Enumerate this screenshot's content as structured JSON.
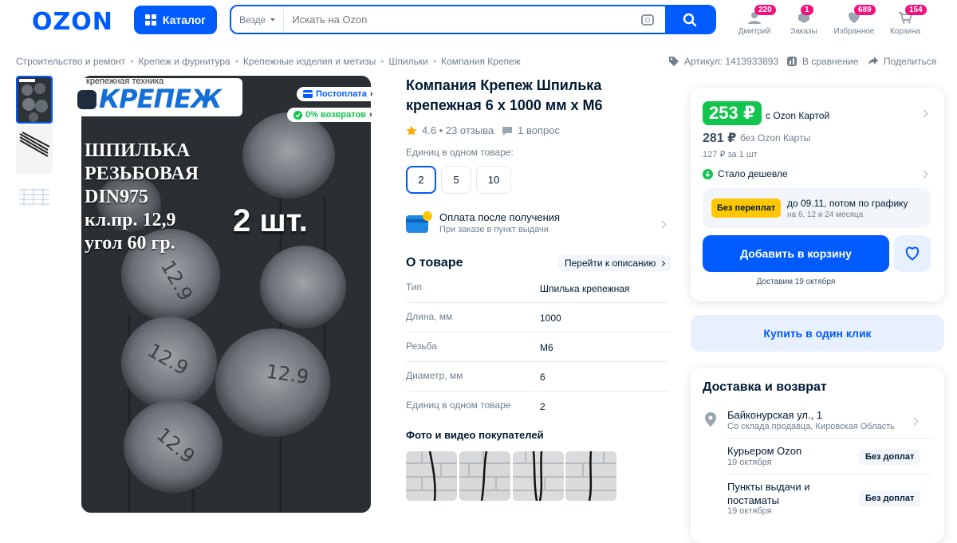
{
  "header": {
    "logo": "OZON",
    "catalog_label": "Каталог",
    "search_scope": "Везде",
    "search_placeholder": "Искать на Ozon",
    "nav": [
      {
        "label": "Дмитрий",
        "badge": "220",
        "icon": "user-icon"
      },
      {
        "label": "Заказы",
        "badge": "1",
        "icon": "box-icon"
      },
      {
        "label": "Избранное",
        "badge": "689",
        "icon": "heart-icon"
      },
      {
        "label": "Корзина",
        "badge": "154",
        "icon": "cart-icon"
      }
    ]
  },
  "breadcrumbs": [
    "Строительство и ремонт",
    "Крепеж и фурнитура",
    "Крепежные изделия и метизы",
    "Шпильки",
    "Компания Крепеж"
  ],
  "meta": {
    "sku": "Артикул: 1413933893",
    "compare": "В сравнение",
    "share": "Поделиться"
  },
  "gallery": {
    "brand_top": "крепежная техника",
    "brand": "КРЕПЕЖ",
    "badge_postpay": "Постоплата",
    "badge_returns": "0% возвратов",
    "overlay": "ШПИЛЬКА\nРЕЗЬБОВАЯ\nDIN975\nкл.пр. 12,9\nугол 60 гр.",
    "qty": "2 шт."
  },
  "product": {
    "title": "Компания Крепеж Шпилька крепежная 6 х 1000 мм х М6",
    "rating": "4.6 • 23 отзыва",
    "questions": "1 вопрос",
    "units_label": "Единиц в одном товаре:",
    "unit_options": [
      "2",
      "5",
      "10"
    ],
    "pay_after_title": "Оплата после получения",
    "pay_after_sub": "При заказе в пункт выдачи",
    "about_title": "О товаре",
    "to_description": "Перейти к описанию",
    "specs": [
      {
        "k": "Тип",
        "v": "Шпилька крепежная"
      },
      {
        "k": "Длина, мм",
        "v": "1000"
      },
      {
        "k": "Резьба",
        "v": "М6"
      },
      {
        "k": "Диаметр, мм",
        "v": "6"
      },
      {
        "k": "Единиц в одном товаре",
        "v": "2"
      }
    ],
    "photos_title": "Фото и видео покупателей"
  },
  "buy": {
    "price_card": "253 ₽",
    "price_card_label": "с Ozon Картой",
    "price_regular": "281 ₽",
    "price_regular_label": "без Ozon Карты",
    "unit_price": "127 ₽ за 1 шт",
    "cheaper": "Стало дешевле",
    "installment_badge": "Без переплат",
    "installment_line1": "до 09.11, потом по графику",
    "installment_line2": "на 6, 12 и 24 месяца",
    "add_to_cart": "Добавить в корзину",
    "delivery_date": "Доставим 19 октября",
    "one_click": "Купить в один клик"
  },
  "delivery": {
    "title": "Доставка и возврат",
    "address": "Байконурская ул., 1",
    "address_sub": "Со склада продавца, Кировская Область",
    "courier": "Курьером Ozon",
    "courier_date": "19 октября",
    "courier_badge": "Без доплат",
    "pickup_line1": "Пункты выдачи и",
    "pickup_line2": "постаматы",
    "pickup_date": "19 октября",
    "pickup_badge": "Без доплат"
  },
  "colors": {
    "accent": "#005bff",
    "green": "#10c44c",
    "badge": "#f1117e",
    "yellow": "#ffc702"
  }
}
